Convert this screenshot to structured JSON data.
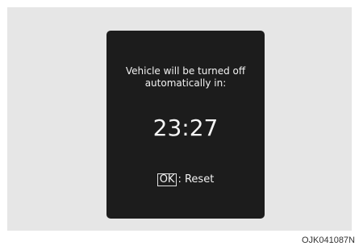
{
  "notification": {
    "message_line1": "Vehicle will be turned off",
    "message_line2": "automatically in:",
    "countdown": "23:27",
    "ok_key": "OK",
    "reset_label": ": Reset"
  },
  "figure_code": "OJK041087N",
  "colors": {
    "screen_background": "#1c1c1c",
    "frame_background": "#e6e6e6",
    "text": "#f2f2f2"
  }
}
